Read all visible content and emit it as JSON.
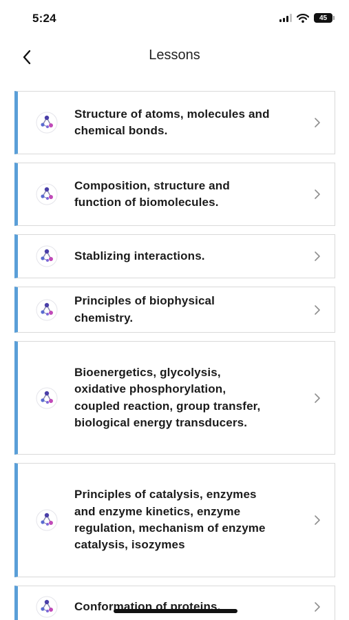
{
  "status_bar": {
    "time": "5:24",
    "battery": "45"
  },
  "nav": {
    "back_icon": "chevron-left-icon",
    "title": "Lessons"
  },
  "lesson_icon": "molecule-icon",
  "row_chevron_icon": "chevron-right-icon",
  "accent_color": "#5a9fd8",
  "lessons": [
    {
      "label": "Structure of atoms, molecules and chemical bonds."
    },
    {
      "label": "Composition, structure and function of biomolecules."
    },
    {
      "label": "Stablizing interactions."
    },
    {
      "label": "Principles of biophysical chemistry."
    },
    {
      "label": "Bioenergetics, glycolysis, oxidative phosphorylation, coupled reaction, group transfer, biological energy transducers."
    },
    {
      "label": "Principles of catalysis, enzymes and enzyme kinetics, enzyme regulation, mechanism of enzyme catalysis, isozymes"
    },
    {
      "label": "Conformation of proteins."
    }
  ]
}
